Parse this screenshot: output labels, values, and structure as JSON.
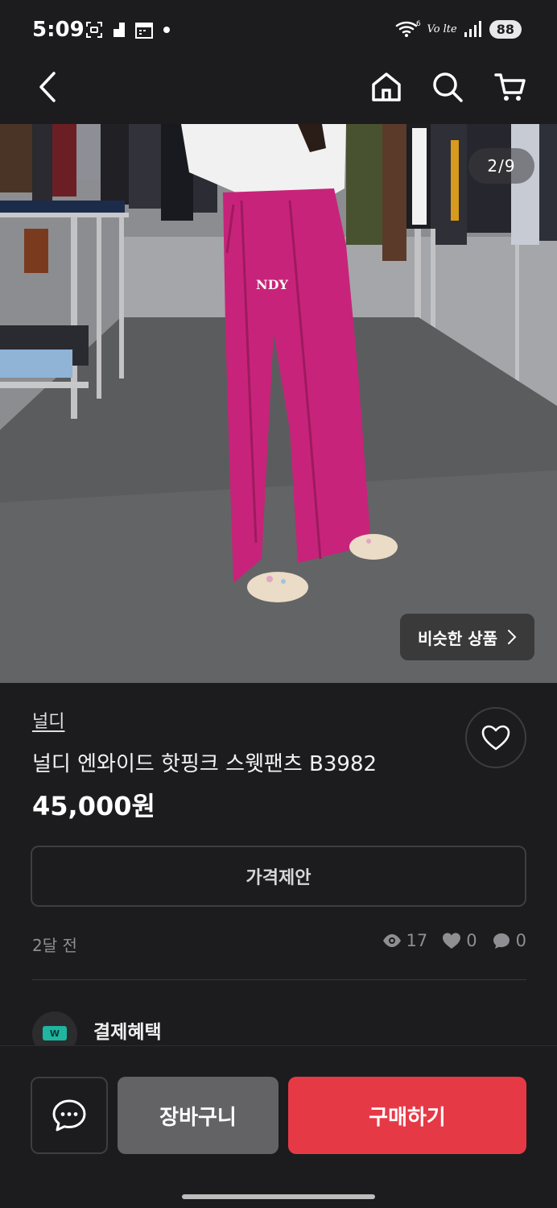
{
  "status_bar": {
    "time": "5:09",
    "volte": "Vo lte",
    "battery": "88",
    "icons": [
      "screenshot-icon",
      "sim-icon",
      "calendar-icon",
      "dot-icon",
      "wifi-icon",
      "signal-icon"
    ]
  },
  "nav": {
    "icons": [
      "back-icon",
      "home-icon",
      "search-icon",
      "cart-icon"
    ]
  },
  "photo": {
    "counter": "2/9",
    "similar_label": "비슷한 상품",
    "logo_text": "NDY"
  },
  "product": {
    "brand": "널디",
    "title": "널디 엔와이드 핫핑크 스웻팬츠 B3982",
    "price": "45,000원",
    "offer_label": "가격제안",
    "posted": "2달 전",
    "views": "17",
    "likes": "0",
    "comments": "0"
  },
  "benefit": {
    "label": "결제혜택",
    "badge": "W"
  },
  "bottom": {
    "cart_label": "장바구니",
    "buy_label": "구매하기"
  },
  "colors": {
    "background": "#1c1c1e",
    "buy": "#e63946",
    "cart": "#636366",
    "pants": "#c8237a"
  }
}
